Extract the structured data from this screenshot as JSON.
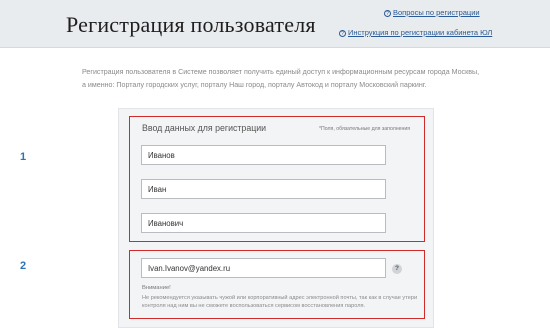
{
  "header": {
    "title": "Регистрация пользователя",
    "links": [
      {
        "icon": "question-circle-icon",
        "label": "Вопросы по регистрации"
      },
      {
        "icon": "question-circle-icon",
        "label": "Инструкция по регистрации кабинета ЮЛ"
      }
    ]
  },
  "intro": "Регистрация пользователя в Системе позволяет получить единый доступ к информационным ресурсам города Москвы, а именно: Порталу городских услуг, порталу Наш город, порталу Автокод и порталу Московский паркинг.",
  "form": {
    "section_title": "Ввод данных для регистрации",
    "required_note": "*Поля, обязательные для заполнения",
    "fields": {
      "last_name": "Иванов",
      "first_name": "Иван",
      "middle_name": "Иванович",
      "email": "Ivan.Ivanov@yandex.ru"
    },
    "help_icon": "?",
    "warning_title": "Внимание!",
    "warning_text": "Не рекомендуется указывать чужой или корпоративный адрес электронной почты, так как в случае утери контроля над ним вы не сможете воспользоваться сервисом восстановления пароля."
  },
  "annotations": {
    "step1": "1",
    "step2": "2",
    "frame_color": "#d12a2a",
    "number_color": "#2e74b5"
  }
}
